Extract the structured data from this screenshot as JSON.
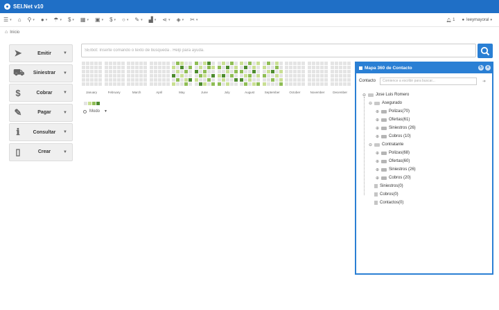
{
  "app": {
    "title": "SEI.Net v10"
  },
  "toolbar": {
    "items": [
      {
        "icon": "menu-icon",
        "glyph": "☰"
      },
      {
        "icon": "home-icon",
        "glyph": "⌂"
      },
      {
        "icon": "search-icon",
        "glyph": "⚲"
      },
      {
        "icon": "user-icon",
        "glyph": "●"
      },
      {
        "icon": "umbrella-icon",
        "glyph": "☂"
      },
      {
        "icon": "dollar-icon",
        "glyph": "$"
      },
      {
        "icon": "grid-icon",
        "glyph": "▦"
      },
      {
        "icon": "image-icon",
        "glyph": "▣"
      },
      {
        "icon": "money-icon",
        "glyph": "$"
      },
      {
        "icon": "circle-icon",
        "glyph": "○"
      },
      {
        "icon": "pencil-icon",
        "glyph": "✎"
      },
      {
        "icon": "chart-icon",
        "glyph": "▟"
      },
      {
        "icon": "share-icon",
        "glyph": "⋖"
      },
      {
        "icon": "shield-icon",
        "glyph": "◈"
      },
      {
        "icon": "wrench-icon",
        "glyph": "✂"
      }
    ],
    "notifications": "1",
    "user": "leeymayoral"
  },
  "breadcrumb": {
    "home": "Inicio"
  },
  "actions": [
    {
      "id": "emitir",
      "label": "Emitir",
      "icon": "paper-plane-icon",
      "glyph": "➤"
    },
    {
      "id": "siniestrar",
      "label": "Siniestrar",
      "icon": "ambulance-icon",
      "glyph": "⛟"
    },
    {
      "id": "cobrar",
      "label": "Cobrar",
      "icon": "dollar-icon",
      "glyph": "$"
    },
    {
      "id": "pagar",
      "label": "Pagar",
      "icon": "pencil-icon",
      "glyph": "✎"
    },
    {
      "id": "consultar",
      "label": "Consultar",
      "icon": "info-icon",
      "glyph": "ℹ"
    },
    {
      "id": "crear",
      "label": "Crear",
      "icon": "document-icon",
      "glyph": "▯"
    }
  ],
  "search": {
    "placeholder": "SEIbot: Inserte comando o texto de búsqueda . Help para ayuda."
  },
  "calendar": {
    "months": [
      "January",
      "February",
      "March",
      "April",
      "May",
      "June",
      "July",
      "August",
      "September",
      "October",
      "November",
      "December"
    ],
    "activity": {
      "May": [
        0,
        2,
        1,
        0,
        0,
        1,
        0,
        3,
        0,
        2,
        0,
        1,
        0,
        2,
        0,
        3,
        0,
        1,
        0,
        0,
        0,
        2,
        0,
        1,
        3,
        1,
        0,
        0,
        2,
        0
      ],
      "June": [
        2,
        0,
        1,
        3,
        0,
        0,
        1,
        0,
        2,
        1,
        3,
        0,
        2,
        0,
        0,
        0,
        2,
        1,
        0,
        3,
        1,
        0,
        0,
        2,
        0,
        0,
        3,
        1,
        0,
        2
      ],
      "July": [
        0,
        1,
        0,
        2,
        0,
        2,
        0,
        3,
        0,
        1,
        0,
        0,
        1,
        0,
        2,
        1,
        3,
        0,
        2,
        0,
        0,
        1,
        0,
        0,
        3,
        2,
        0,
        1,
        0,
        0
      ],
      "August": [
        1,
        0,
        2,
        0,
        1,
        0,
        3,
        0,
        1,
        0,
        2,
        0,
        0,
        3,
        0,
        0,
        1,
        2,
        0,
        1,
        3,
        0,
        1,
        0,
        0,
        0,
        2,
        0,
        1,
        2
      ],
      "September": [
        0,
        2,
        0,
        1,
        0,
        1,
        0,
        0,
        2,
        0,
        0,
        1,
        3,
        0,
        1,
        2,
        0,
        0,
        1,
        0,
        0,
        0,
        2,
        0,
        1,
        1,
        0,
        0,
        0,
        2
      ]
    },
    "palette": [
      "#e4e4e4",
      "#c9df93",
      "#8fbd55",
      "#4d8b2e"
    ],
    "mode_label": "Modo"
  },
  "panel": {
    "title": "Mapa 360 de Contacto",
    "contact_label": "Contacto",
    "contact_placeholder": "Comience a escribir para buscar...",
    "tree": {
      "root": "Jose Luis Romero",
      "asegurado": {
        "label": "Asegurado",
        "children": [
          "Polizas(70)",
          "Ofertas(61)",
          "Siniestros (26)",
          "Cobros (10)"
        ]
      },
      "contratante": {
        "label": "Contratante",
        "children": [
          "Polizas(68)",
          "Ofertas(60)",
          "Siniestros (26)",
          "Cobros (20)"
        ]
      },
      "leaves": [
        "Siniestros(0)",
        "Cobros(0)",
        "Contactos(0)"
      ]
    }
  }
}
